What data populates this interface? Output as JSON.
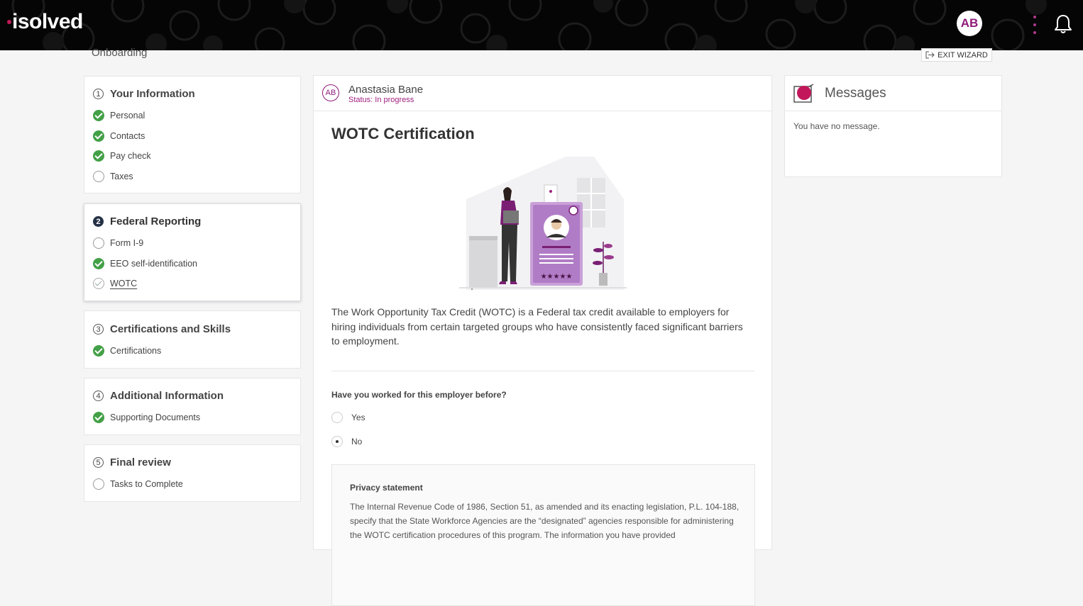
{
  "app": {
    "logo": "isolved"
  },
  "topbar": {
    "avatar_initials": "AB"
  },
  "page": {
    "title": "Onboarding",
    "exit_label": "EXIT WIZARD"
  },
  "steps": [
    {
      "number": "1",
      "title": "Your Information",
      "items": [
        {
          "label": "Personal",
          "state": "done"
        },
        {
          "label": "Contacts",
          "state": "done"
        },
        {
          "label": "Pay check",
          "state": "done"
        },
        {
          "label": "Taxes",
          "state": "todo"
        }
      ]
    },
    {
      "number": "2",
      "title": "Federal Reporting",
      "items": [
        {
          "label": "Form I-9",
          "state": "todo"
        },
        {
          "label": "EEO self-identification",
          "state": "done"
        },
        {
          "label": "WOTC",
          "state": "current"
        }
      ]
    },
    {
      "number": "3",
      "title": "Certifications and Skills",
      "items": [
        {
          "label": "Certifications",
          "state": "done"
        }
      ]
    },
    {
      "number": "4",
      "title": "Additional Information",
      "items": [
        {
          "label": "Supporting Documents",
          "state": "done"
        }
      ]
    },
    {
      "number": "5",
      "title": "Final review",
      "items": [
        {
          "label": "Tasks to Complete",
          "state": "todo"
        }
      ]
    }
  ],
  "employee": {
    "initials": "AB",
    "name": "Anastasia Bane",
    "status": "Status: In progress"
  },
  "wotc": {
    "title": "WOTC Certification",
    "intro": "The Work Opportunity Tax Credit (WOTC) is a Federal tax credit available to employers for hiring individuals from certain targeted groups who have consistently faced significant barriers to employment.",
    "question": "Have you worked for this employer before?",
    "options": [
      {
        "label": "Yes",
        "selected": false
      },
      {
        "label": "No",
        "selected": true
      }
    ],
    "privacy_title": "Privacy statement",
    "privacy_body": "The Internal Revenue Code of 1986, Section 51, as amended and its enacting legislation, P.L. 104-188, specify that the State Workforce Agencies are the “designated” agencies responsible for administering the WOTC certification procedures of this program. The information you have provided"
  },
  "messages": {
    "title": "Messages",
    "empty": "You have no message."
  },
  "colors": {
    "accent": "#a0207f",
    "success": "#43a047",
    "topbar": "#050505"
  }
}
